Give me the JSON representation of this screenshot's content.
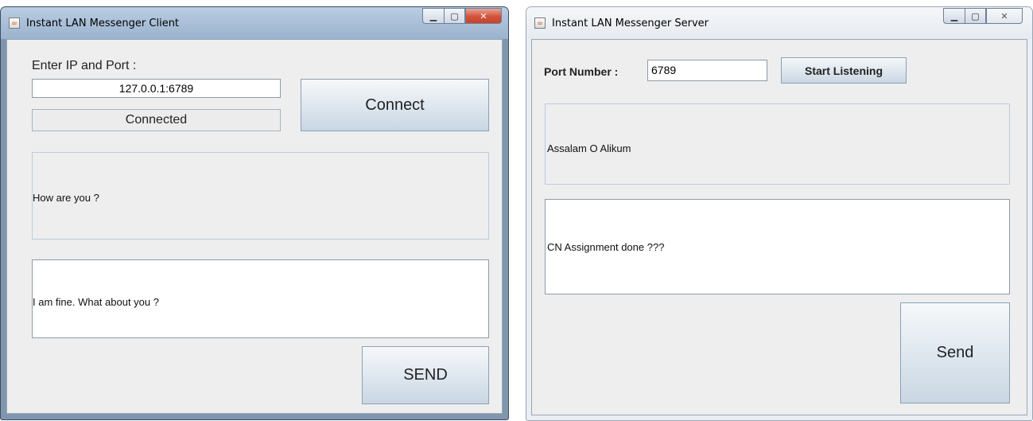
{
  "client": {
    "title": "Instant LAN Messenger Client",
    "ip_label": "Enter IP and Port :",
    "ip_value": "127.0.0.1:6789",
    "status": "Connected",
    "connect_label": "Connect",
    "received_message": "How are you ?",
    "outgoing_message": "I am fine. What about you ?",
    "send_label": "SEND"
  },
  "server": {
    "title": "Instant LAN Messenger Server",
    "port_label": "Port Number :",
    "port_value": "6789",
    "listen_label": "Start Listening",
    "received_message": "Assalam O Alikum",
    "outgoing_message": "CN Assignment done ???",
    "send_label": "Send"
  },
  "icons": {
    "app": "java-app-icon",
    "minimize": "minimize-icon",
    "maximize": "maximize-icon",
    "close": "close-icon"
  },
  "colors": {
    "client_titlebar": "#a7bdd6",
    "client_close": "#d2523a",
    "server_titlebar": "#ebeff4",
    "panel_border": "#b8cbe0",
    "content_bg": "#eeeeee"
  }
}
